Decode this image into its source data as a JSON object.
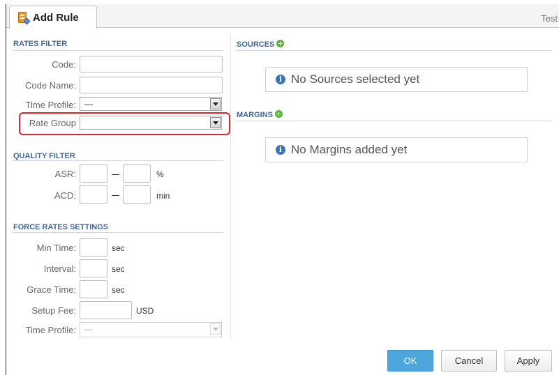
{
  "tab": {
    "title": "Add Rule",
    "right_text": "Test"
  },
  "rates_filter": {
    "title": "RATES FILTER",
    "code": {
      "label": "Code:",
      "value": ""
    },
    "code_name": {
      "label": "Code Name:",
      "value": ""
    },
    "time_profile": {
      "label": "Time Profile:",
      "value": "—"
    },
    "rate_group": {
      "label": "Rate Group",
      "value": ""
    }
  },
  "quality_filter": {
    "title": "QUALITY FILTER",
    "asr": {
      "label": "ASR:",
      "unit": "%",
      "from": "",
      "to": ""
    },
    "acd": {
      "label": "ACD:",
      "unit": "min",
      "from": "",
      "to": ""
    }
  },
  "force_rates": {
    "title": "FORCE RATES SETTINGS",
    "min_time": {
      "label": "Min Time:",
      "unit": "sec",
      "value": ""
    },
    "interval": {
      "label": "Interval:",
      "unit": "sec",
      "value": ""
    },
    "grace_time": {
      "label": "Grace Time:",
      "unit": "sec",
      "value": ""
    },
    "setup_fee": {
      "label": "Setup Fee:",
      "unit": "USD",
      "value": ""
    },
    "time_profile": {
      "label": "Time Profile:",
      "value": "—"
    }
  },
  "sources": {
    "title": "SOURCES",
    "empty_text": "No Sources selected yet"
  },
  "margins": {
    "title": "MARGINS",
    "empty_text": "No Margins added yet"
  },
  "buttons": {
    "ok": "OK",
    "cancel": "Cancel",
    "apply": "Apply"
  },
  "icons": {
    "tab": "rule-document-icon",
    "add": "plus-circle-icon",
    "info": "info-icon"
  },
  "colors": {
    "accent": "#4ea6dc",
    "section_title": "#41669a",
    "highlight": "#e0252b",
    "add": "#5bb03d"
  }
}
